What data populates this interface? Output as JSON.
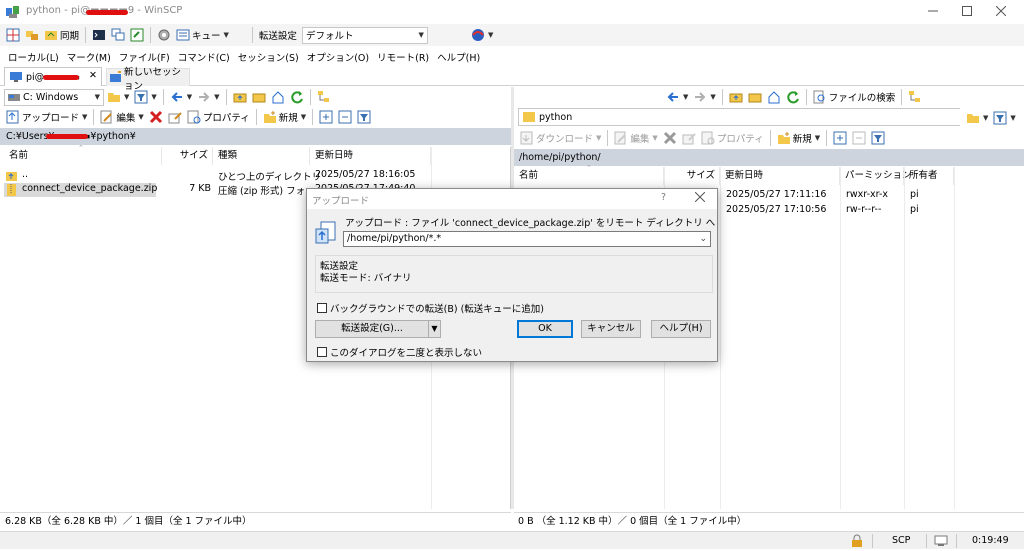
{
  "window": {
    "title": "python - pi@▬▬▬▬9 - WinSCP"
  },
  "toolbar_main": {
    "sync_label": "同期",
    "queue_label": "キュー",
    "transfer_settings_label": "転送設定",
    "transfer_preset": "デフォルト"
  },
  "menu": [
    "ローカル(L)",
    "マーク(M)",
    "ファイル(F)",
    "コマンド(C)",
    "セッション(S)",
    "オプション(O)",
    "リモート(R)",
    "ヘルプ(H)"
  ],
  "tabs": {
    "session_label": "pi@▬▬▬▬",
    "new_session_label": "新しいセッション"
  },
  "local": {
    "drive": "C: Windows",
    "upload_label": "アップロード",
    "edit_label": "編集",
    "properties_label": "プロパティ",
    "new_label": "新規",
    "path": "C:¥Users¥▬▬▬▬¥python¥",
    "columns": {
      "name": "名前",
      "size": "サイズ",
      "type": "種類",
      "modified": "更新日時"
    },
    "rows": [
      {
        "name": "..",
        "size": "",
        "type": "ひとつ上のディレクトリ",
        "modified": "2025/05/27  18:16:05"
      },
      {
        "name": "connect_device_package.zip",
        "size": "7 KB",
        "type": "圧縮 (zip 形式) フォ...",
        "modified": "2025/05/27  17:49:40"
      }
    ],
    "status": "6.28 KB（全 6.28 KB 中）／ 1 個目（全 1 ファイル中）"
  },
  "remote": {
    "dir_name": "python",
    "find_files_label": "ファイルの検索",
    "download_label": "ダウンロード",
    "edit_label": "編集",
    "properties_label": "プロパティ",
    "new_label": "新規",
    "path": "/home/pi/python/",
    "columns": {
      "name": "名前",
      "size": "サイズ",
      "modified": "更新日時",
      "permissions": "パーミッション",
      "owner": "所有者"
    },
    "rows": [
      {
        "modified": "2025/05/27 17:11:16",
        "permissions": "rwxr-xr-x",
        "owner": "pi"
      },
      {
        "modified": "2025/05/27 17:10:56",
        "permissions": "rw-r--r--",
        "owner": "pi"
      }
    ],
    "status": "0 B （全 1.12 KB 中）／ 0 個目（全 1 ファイル中）"
  },
  "statusbar": {
    "protocol": "SCP",
    "elapsed": "0:19:49"
  },
  "dialog": {
    "title": "アップロード",
    "help_glyph": "?",
    "message": "アップロード : ファイル 'connect_device_package.zip' をリモート ディレクトリ へ",
    "target_path": "/home/pi/python/*.*",
    "group_title": "転送設定",
    "transfer_mode": "転送モード: バイナリ",
    "background_label": "バックグラウンドでの転送(B) (転送キューに追加)",
    "transfer_settings_button": "転送設定(G)...",
    "ok_button": "OK",
    "cancel_button": "キャンセル",
    "help_button": "ヘルプ(H)",
    "dont_show_label": "このダイアログを二度と表示しない"
  },
  "colors": {
    "accent_blue": "#0078d7",
    "panel_header": "#cdd4dd",
    "selection": "#cce8ff",
    "folder": "#f3c74a",
    "redaction": "#e01010"
  }
}
